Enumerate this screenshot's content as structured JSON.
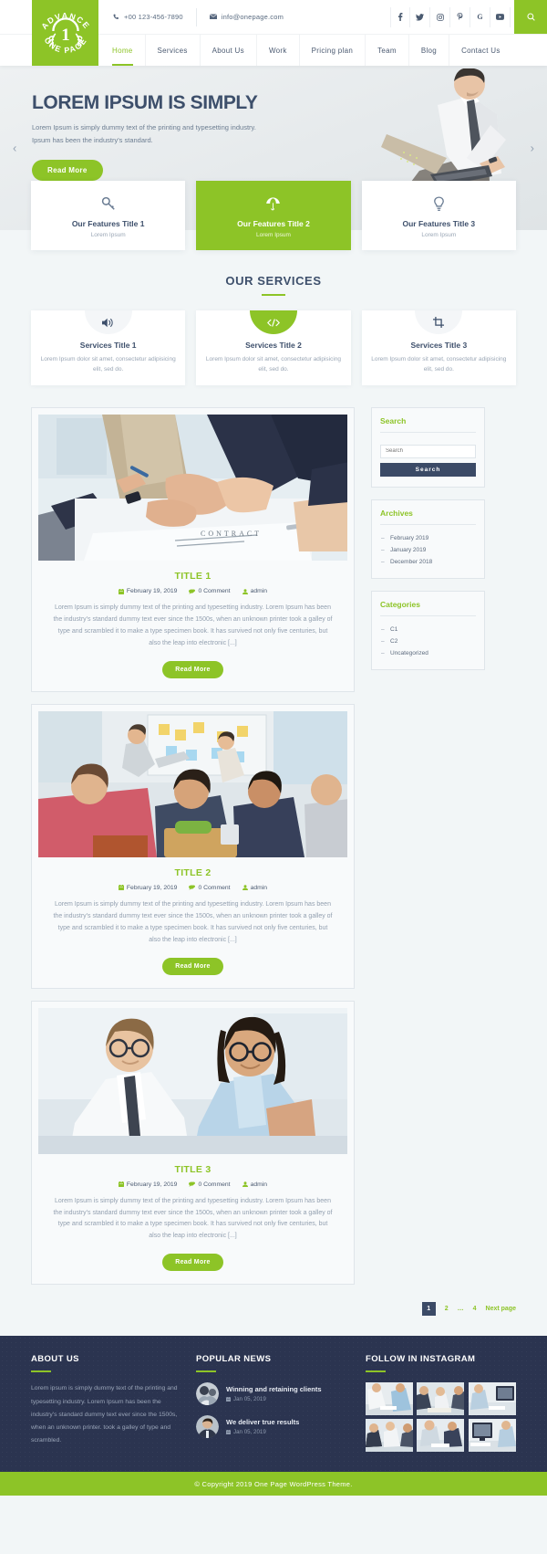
{
  "topbar": {
    "phone": "+00 123-456-7890",
    "email": "info@onepage.com",
    "phone_icon": "phone-icon",
    "email_icon": "envelope-icon",
    "social": [
      {
        "name": "facebook-icon",
        "glyph": "f"
      },
      {
        "name": "twitter-icon",
        "glyph": "t"
      },
      {
        "name": "instagram-icon",
        "glyph": "i"
      },
      {
        "name": "pinterest-icon",
        "glyph": "p"
      },
      {
        "name": "google-plus-icon",
        "glyph": "G"
      },
      {
        "name": "youtube-icon",
        "glyph": "y"
      }
    ],
    "search_icon": "search-icon"
  },
  "logo": {
    "top_text": "ADVANCE",
    "number": "1",
    "bottom_text": "ONE PAGE"
  },
  "nav": {
    "items": [
      {
        "label": "Home",
        "active": true
      },
      {
        "label": "Services",
        "active": false
      },
      {
        "label": "About Us",
        "active": false
      },
      {
        "label": "Work",
        "active": false
      },
      {
        "label": "Pricing plan",
        "active": false
      },
      {
        "label": "Team",
        "active": false
      },
      {
        "label": "Blog",
        "active": false
      },
      {
        "label": "Contact Us",
        "active": false
      }
    ]
  },
  "hero": {
    "title": "LOREM IPSUM IS SIMPLY",
    "subtitle_line1": "Lorem Ipsum is simply dummy text of the printing and typesetting industry.",
    "subtitle_line2": "Ipsum has been the industry's standard.",
    "button": "Read More",
    "prev_icon": "chevron-left-icon",
    "next_icon": "chevron-right-icon"
  },
  "features": [
    {
      "icon": "key-icon",
      "title": "Our Features Title 1",
      "sub": "Lorem Ipsum",
      "highlight": false
    },
    {
      "icon": "umbrella-icon",
      "title": "Our Features Title 2",
      "sub": "Lorem Ipsum",
      "highlight": true
    },
    {
      "icon": "lightbulb-icon",
      "title": "Our Features Title 3",
      "sub": "Lorem Ipsum",
      "highlight": false
    }
  ],
  "services": {
    "heading": "OUR SERVICES",
    "items": [
      {
        "icon": "speaker-icon",
        "title": "Services Title 1",
        "desc": "Lorem Ipsum dolor sit amet, consectetur adipisicing elit, sed do.",
        "highlight": false
      },
      {
        "icon": "code-icon",
        "title": "Services Title 2",
        "desc": "Lorem Ipsum dolor sit amet, consectetur adipisicing elit, sed do.",
        "highlight": true
      },
      {
        "icon": "crop-icon",
        "title": "Services Title 3",
        "desc": "Lorem Ipsum dolor sit amet, consectetur adipisicing elit, sed do.",
        "highlight": false
      }
    ]
  },
  "posts": [
    {
      "title": "TITLE 1",
      "date": "February 19, 2019",
      "comments": "0 Comment",
      "author": "admin",
      "excerpt": "Lorem Ipsum is simply dummy text of the printing and typesetting industry. Lorem Ipsum has been the industry's standard dummy text ever since the 1500s, when an unknown printer took a galley of type and scrambled it to make a type specimen book. It has survived not only five centuries, but also the leap into electronic [...]",
      "button": "Read More",
      "image": "business-handshake-contract-photo"
    },
    {
      "title": "TITLE 2",
      "date": "February 19, 2019",
      "comments": "0 Comment",
      "author": "admin",
      "excerpt": "Lorem Ipsum is simply dummy text of the printing and typesetting industry. Lorem Ipsum has been the industry's standard dummy text ever since the 1500s, when an unknown printer took a galley of type and scrambled it to make a type specimen book. It has survived not only five centuries, but also the leap into electronic [...]",
      "button": "Read More",
      "image": "team-workshop-meeting-photo"
    },
    {
      "title": "TITLE 3",
      "date": "February 19, 2019",
      "comments": "0 Comment",
      "author": "admin",
      "excerpt": "Lorem Ipsum is simply dummy text of the printing and typesetting industry. Lorem Ipsum has been the industry's standard dummy text ever since the 1500s, when an unknown printer took a galley of type and scrambled it to make a type specimen book. It has survived not only five centuries, but also the leap into electronic [...]",
      "button": "Read More",
      "image": "two-business-people-portrait-photo"
    }
  ],
  "sidebar": {
    "search": {
      "title": "Search",
      "placeholder": "Search",
      "button": "Search"
    },
    "archives": {
      "title": "Archives",
      "items": [
        "February 2019",
        "January 2019",
        "December 2018"
      ]
    },
    "categories": {
      "title": "Categories",
      "items": [
        "C1",
        "C2",
        "Uncategorized"
      ]
    }
  },
  "pagination": {
    "pages": [
      "1",
      "2",
      "…",
      "4"
    ],
    "current": "1",
    "next": "Next page"
  },
  "footer": {
    "about": {
      "heading": "ABOUT US",
      "text": "Lorem ipsum is simply dummy text of the printing and typesetting industry. Lorem Ipsum has been the industry's standard dummy text ever since the 1500s, when an unknown printer. took a galley of type and scrambled."
    },
    "news": {
      "heading": "POPULAR NEWS",
      "items": [
        {
          "title": "Winning and retaining clients",
          "date": "Jan 05, 2019",
          "date_icon": "calendar-icon"
        },
        {
          "title": "We deliver true results",
          "date": "Jan 05, 2019",
          "date_icon": "calendar-icon"
        }
      ]
    },
    "instagram": {
      "heading": "FOLLOW IN INSTAGRAM",
      "cells": [
        "office-desk-photo",
        "team-meeting-photo",
        "workspace-photo",
        "business-group-photo",
        "coworking-photo",
        "computer-desk-photo"
      ]
    }
  },
  "copyright": "© Copyright 2019 One Page WordPress Theme.",
  "colors": {
    "accent_green": "#8dc427",
    "dark_navy": "#2b3450",
    "heading_blue": "#3d4f6b"
  }
}
